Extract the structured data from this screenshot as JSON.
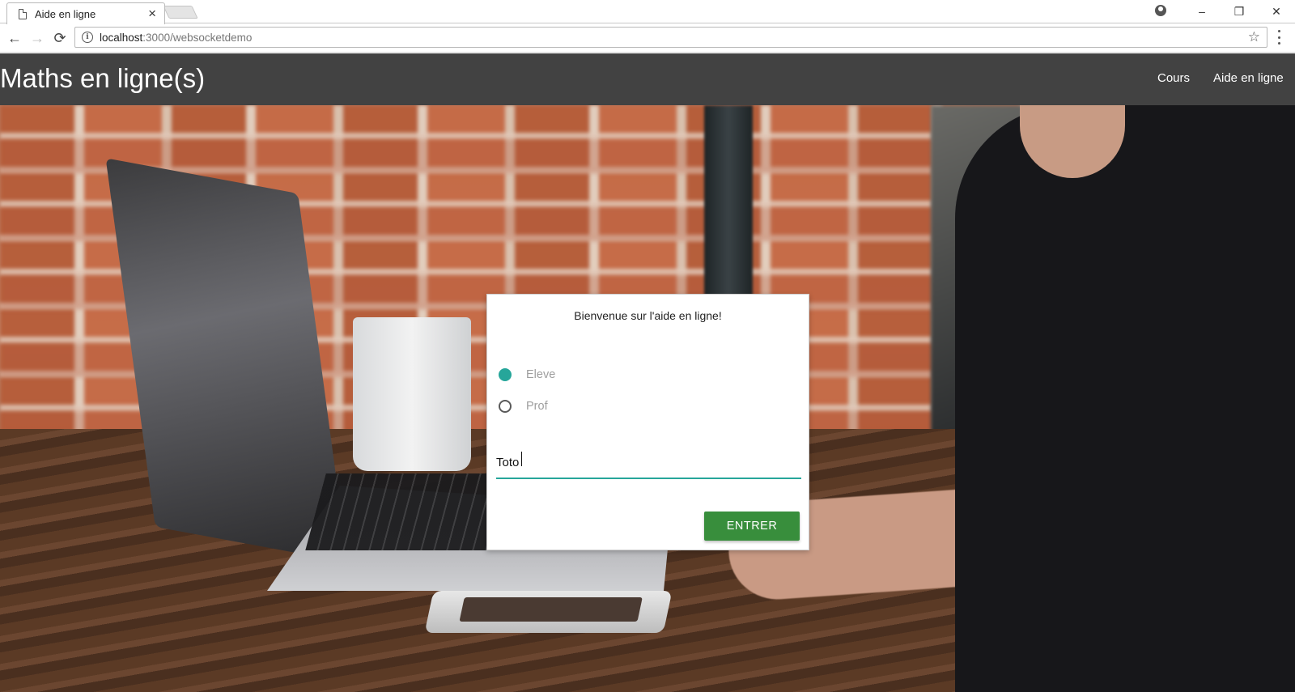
{
  "browser": {
    "tab_title": "Aide en ligne",
    "tab_close": "×",
    "url_host": "localhost",
    "url_path": ":3000/websocketdemo",
    "window_controls": {
      "minimize": "–",
      "restore": "❐",
      "close": "✕"
    },
    "nav": {
      "back": "←",
      "forward": "→",
      "reload": "⟳"
    },
    "bookmark_star": "☆"
  },
  "appbar": {
    "brand": "Maths en ligne(s)",
    "links": [
      {
        "label": "Cours"
      },
      {
        "label": "Aide en ligne"
      }
    ],
    "background": "#424242"
  },
  "login": {
    "title": "Bienvenue sur l'aide en ligne!",
    "roles": [
      {
        "label": "Eleve",
        "checked": true
      },
      {
        "label": "Prof",
        "checked": false
      }
    ],
    "name_value": "Toto",
    "submit_label": "ENTRER",
    "accent_color": "#26a69a",
    "button_color": "#388e3c"
  }
}
